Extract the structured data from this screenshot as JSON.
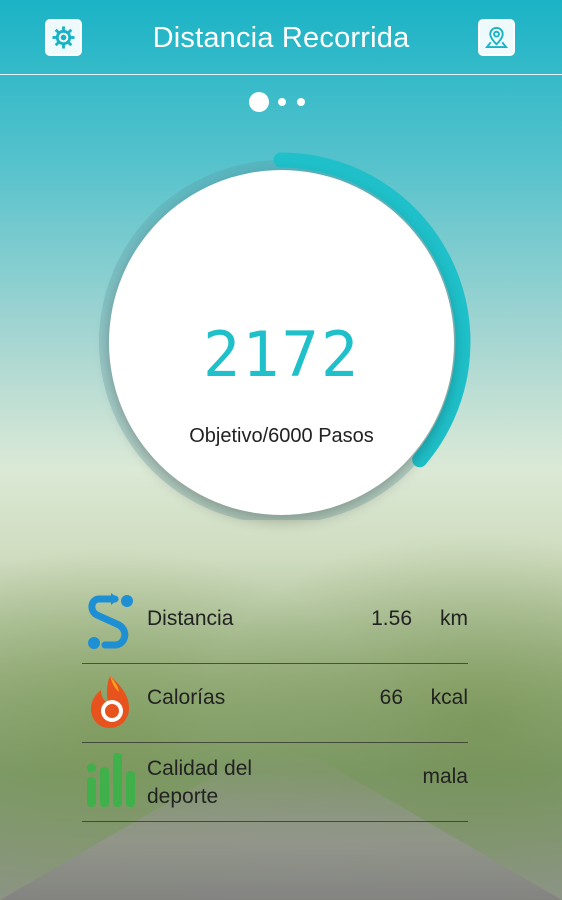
{
  "header": {
    "title": "Distancia Recorrida",
    "left_icon": "settings-gear-icon",
    "right_icon": "map-location-icon"
  },
  "pager": {
    "pages": 3,
    "current": 1
  },
  "progress": {
    "steps": "2172",
    "goal_text": "Objetivo/6000 Pasos",
    "fraction": 0.362,
    "color": "#1fc0c9"
  },
  "stats": [
    {
      "icon": "distance-icon",
      "label": "Distancia",
      "value": "1.56",
      "unit": "km"
    },
    {
      "icon": "calories-flame-icon",
      "label": "Calorías",
      "value": "66",
      "unit": "kcal"
    },
    {
      "icon": "quality-bars-icon",
      "label_line1": "Calidad del",
      "label_line2": "deporte",
      "value": "mala",
      "unit": ""
    }
  ]
}
